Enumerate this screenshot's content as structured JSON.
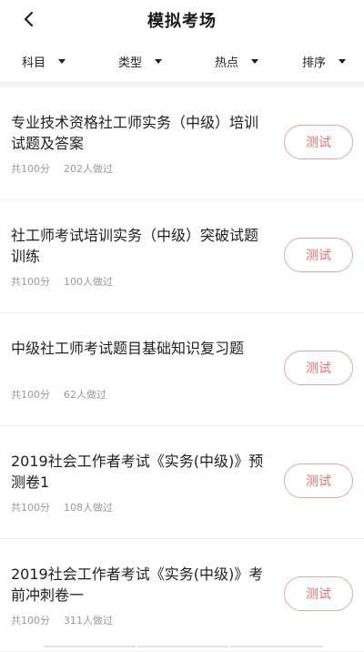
{
  "header": {
    "title": "模拟考场"
  },
  "filters": [
    {
      "label": "科目"
    },
    {
      "label": "类型"
    },
    {
      "label": "热点"
    },
    {
      "label": "排序"
    }
  ],
  "items": [
    {
      "title": "专业技术资格社工师实务（中级）培训试题及答案",
      "total": "共100分",
      "count": "202人做过",
      "button": "测试"
    },
    {
      "title": "社工师考试培训实务（中级）突破试题训练",
      "total": "共100分",
      "count": "100人做过",
      "button": "测试"
    },
    {
      "title": "中级社工师考试题目基础知识复习题",
      "total": "共100分",
      "count": "62人做过",
      "button": "测试"
    },
    {
      "title": "2019社会工作者考试《实务(中级)》预测卷1",
      "total": "共100分",
      "count": "108人做过",
      "button": "测试"
    },
    {
      "title": "2019社会工作者考试《实务(中级)》考前冲刺卷一",
      "total": "共100分",
      "count": "311人做过",
      "button": "测试"
    }
  ],
  "icons": {
    "back": "back-arrow-icon",
    "caret": "caret-down-icon"
  },
  "colors": {
    "accent": "#e8716a",
    "border": "#e9a4a0"
  }
}
